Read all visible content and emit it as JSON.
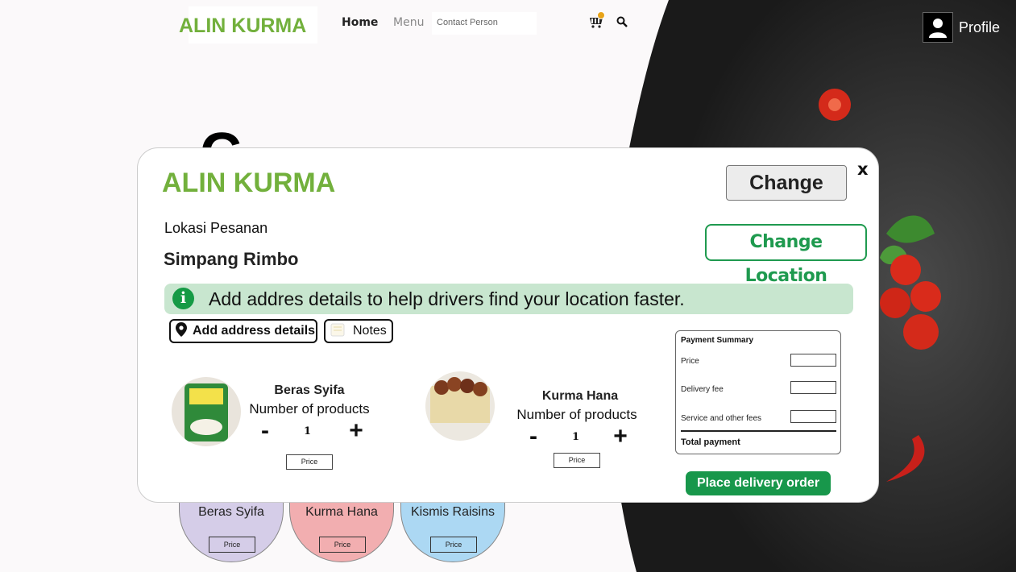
{
  "header": {
    "brand": "ALIN KURMA",
    "nav_home": "Home",
    "nav_menu": "Menu",
    "nav_contact": "Contact Person",
    "profile_label": "Profile"
  },
  "background": {
    "big_letter": "C",
    "products": [
      {
        "name": "Beras Syifa",
        "price_label": "Price",
        "color": "#d5cde8"
      },
      {
        "name": "Kurma Hana",
        "price_label": "Price",
        "color": "#f2aeb0"
      },
      {
        "name": "Kismis Raisins",
        "price_label": "Price",
        "color": "#acd8f3"
      }
    ]
  },
  "modal": {
    "brand": "ALIN KURMA",
    "close_label": "x",
    "change_label": "Change",
    "location_label": "Lokasi Pesanan",
    "location_value": "Simpang Rimbo",
    "change_location_label": "Change Location",
    "info_text": "Add addres details to help drivers find your location faster.",
    "add_address_label": "Add address details",
    "notes_label": "Notes",
    "items": [
      {
        "name": "Beras Syifa",
        "count_label": "Number of products",
        "minus": "-",
        "qty": "1",
        "plus": "+",
        "price_label": "Price"
      },
      {
        "name": "Kurma Hana",
        "count_label": "Number of products",
        "minus": "-",
        "qty": "1",
        "plus": "+",
        "price_label": "Price"
      }
    ],
    "payment": {
      "title": "Payment Summary",
      "rows": [
        "Price",
        "Delivery fee",
        "Service and other fees"
      ],
      "total_label": "Total payment"
    },
    "order_label": "Place delivery order"
  },
  "colors": {
    "brand_green": "#72b03c",
    "action_green": "#18974b",
    "info_bg": "#c8e6cf"
  }
}
